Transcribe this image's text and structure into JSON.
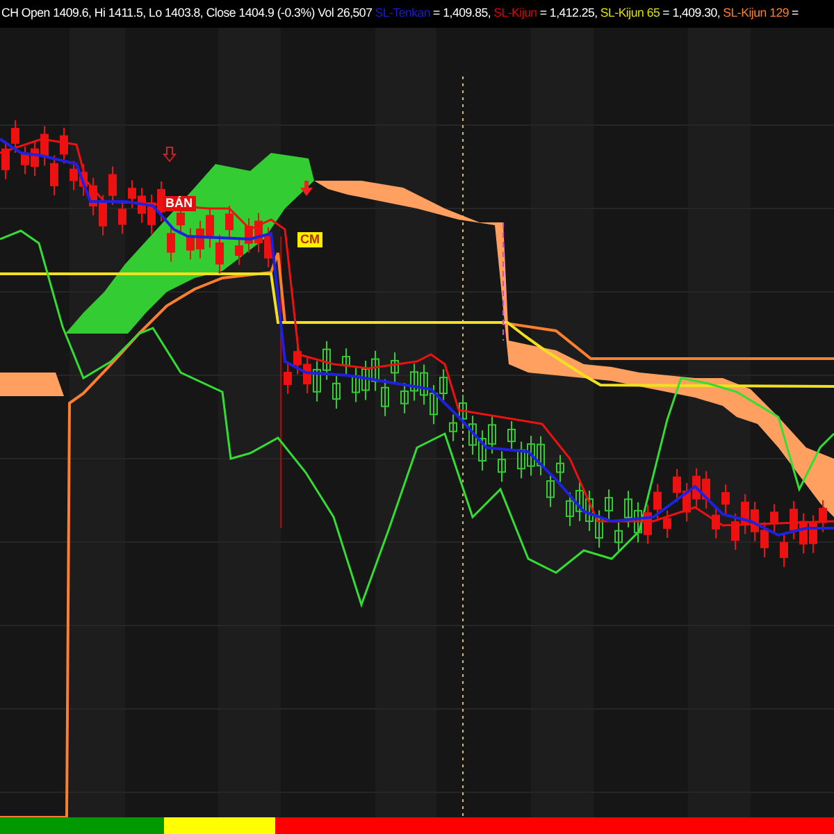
{
  "header": {
    "ohlc_text": "CH Open 1409.6, Hi 1411.5, Lo 1403.8, Close 1404.9 (-0.3%) Vol 26,507",
    "indicators": [
      {
        "name": "SL-Tenkan",
        "color": "#1a1ad0",
        "value": "= 1,409.85,"
      },
      {
        "name": "SL-Kijun",
        "color": "#e00000",
        "value": "= 1,412.25,"
      },
      {
        "name": "SL-Kijun 65",
        "color": "#e0e000",
        "value": "= 1,409.30,"
      },
      {
        "name": "SL-Kijun 129",
        "color": "#ff7f30",
        "value": "="
      }
    ]
  },
  "chart": {
    "signals": [
      {
        "label": "BÁN",
        "kind": "sell"
      },
      {
        "label": "CM",
        "kind": "cm"
      }
    ]
  },
  "signal_ribbon": [
    {
      "color": "#009900"
    },
    {
      "color": "#ffff00"
    },
    {
      "color": "#ff0000"
    }
  ]
}
